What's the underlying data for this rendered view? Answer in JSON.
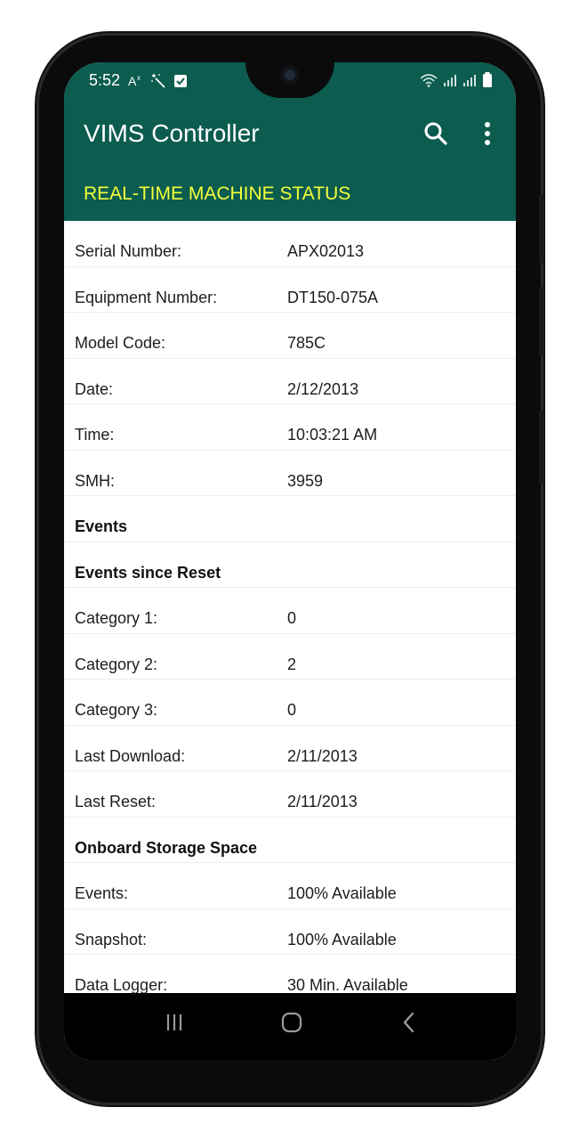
{
  "status_bar": {
    "time": "5:52",
    "icons": [
      "translate-icon",
      "magic-wand-icon",
      "checkbox-icon"
    ],
    "right_icons": [
      "wifi-icon",
      "signal-icon",
      "signal-icon",
      "battery-icon"
    ]
  },
  "app_bar": {
    "title": "VIMS Controller",
    "actions": [
      "search-icon",
      "more-vert-icon"
    ]
  },
  "section": {
    "title": "REAL-TIME MACHINE STATUS"
  },
  "rows": [
    {
      "label": "Serial Number:",
      "value": "APX02013"
    },
    {
      "label": "Equipment Number:",
      "value": "DT150-075A"
    },
    {
      "label": "Model Code:",
      "value": "785C"
    },
    {
      "label": "Date:",
      "value": "2/12/2013"
    },
    {
      "label": "Time:",
      "value": "10:03:21 AM"
    },
    {
      "label": "SMH:",
      "value": "3959"
    },
    {
      "label": "Events",
      "value": "",
      "heading": true
    },
    {
      "label": "Events since Reset",
      "value": "",
      "heading": true
    },
    {
      "label": "Category 1:",
      "value": "0"
    },
    {
      "label": "Category 2:",
      "value": "2"
    },
    {
      "label": "Category 3:",
      "value": "0"
    },
    {
      "label": "Last Download:",
      "value": "2/11/2013"
    },
    {
      "label": "Last Reset:",
      "value": "2/11/2013"
    },
    {
      "label": "Onboard Storage Space",
      "value": "",
      "heading": true
    },
    {
      "label": "Events:",
      "value": "100% Available"
    },
    {
      "label": "Snapshot:",
      "value": "100% Available"
    },
    {
      "label": "Data Logger:",
      "value": "30 Min. Available"
    }
  ],
  "colors": {
    "primary": "#0c5c50",
    "accent": "#f4ff3a"
  },
  "nav": [
    "recents-icon",
    "home-icon",
    "back-icon"
  ]
}
